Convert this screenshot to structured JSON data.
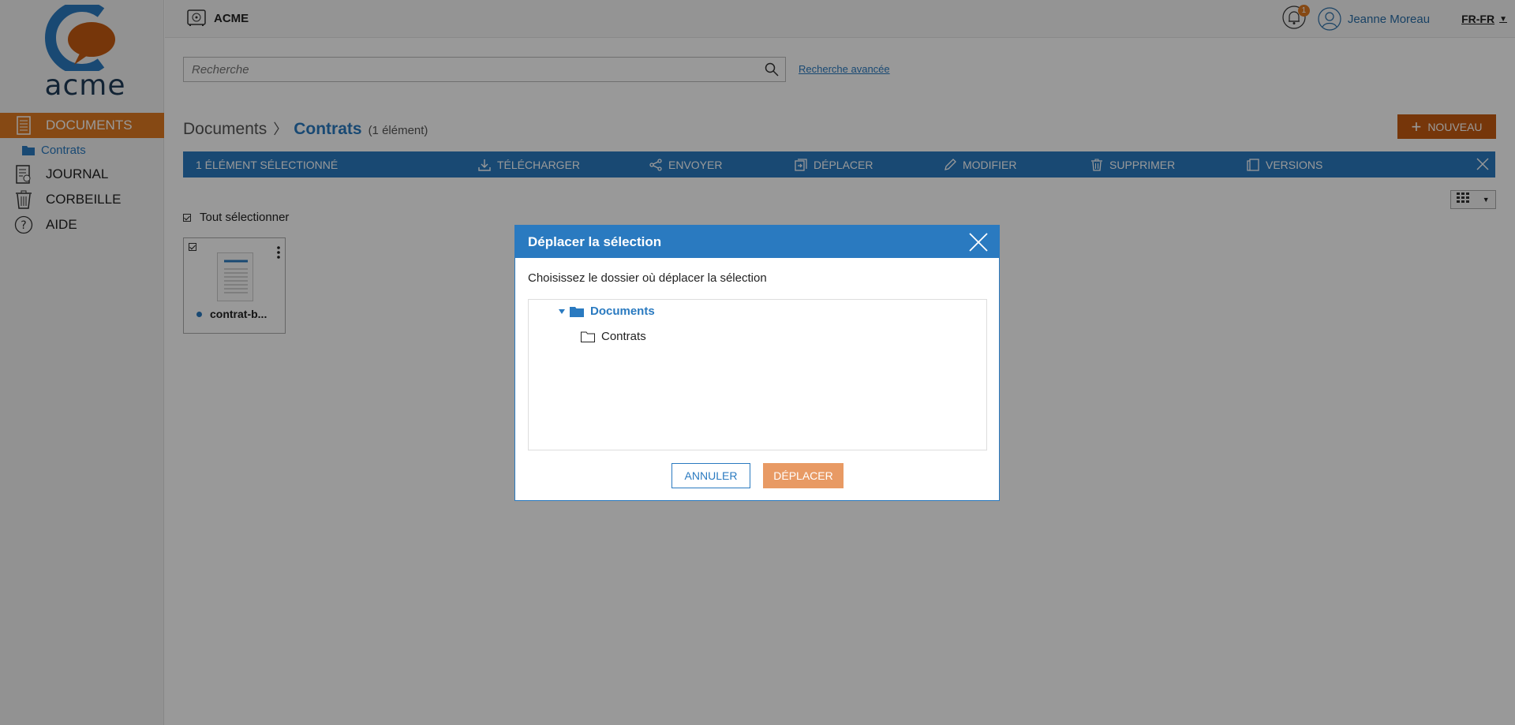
{
  "brand": {
    "logo_text": "acme"
  },
  "sidebar": {
    "items": [
      {
        "label": "DOCUMENTS",
        "icon": "document-list-icon",
        "active": true
      },
      {
        "label": "Contrats",
        "icon": "folder-icon",
        "sub": true
      },
      {
        "label": "JOURNAL",
        "icon": "journal-icon"
      },
      {
        "label": "CORBEILLE",
        "icon": "trash-icon"
      },
      {
        "label": "AIDE",
        "icon": "help-icon"
      }
    ]
  },
  "topbar": {
    "app_name": "ACME",
    "notifications_count": "1",
    "user_name": "Jeanne Moreau",
    "language": "FR-FR"
  },
  "search": {
    "placeholder": "Recherche",
    "advanced_link": "Recherche avancée"
  },
  "breadcrumb": {
    "root": "Documents",
    "separator": "〉",
    "current": "Contrats",
    "count": "(1 élément)"
  },
  "new_button": "NOUVEAU",
  "actionbar": {
    "selection": "1 ÉLÉMENT SÉLECTIONNÉ",
    "download": "TÉLÉCHARGER",
    "send": "ENVOYER",
    "move": "DÉPLACER",
    "edit": "MODIFIER",
    "delete": "SUPPRIMER",
    "versions": "VERSIONS"
  },
  "content": {
    "select_all": "Tout sélectionner",
    "files": [
      {
        "name": "contrat-b..."
      }
    ]
  },
  "modal": {
    "title": "Déplacer la sélection",
    "description": "Choisissez le dossier où déplacer la sélection",
    "tree": {
      "root": "Documents",
      "child": "Contrats"
    },
    "cancel": "ANNULER",
    "confirm": "DÉPLACER"
  },
  "colors": {
    "primary": "#2a7ac0",
    "accent": "#e07a22",
    "new_button": "#c55a11",
    "confirm_button": "#e89a64"
  }
}
